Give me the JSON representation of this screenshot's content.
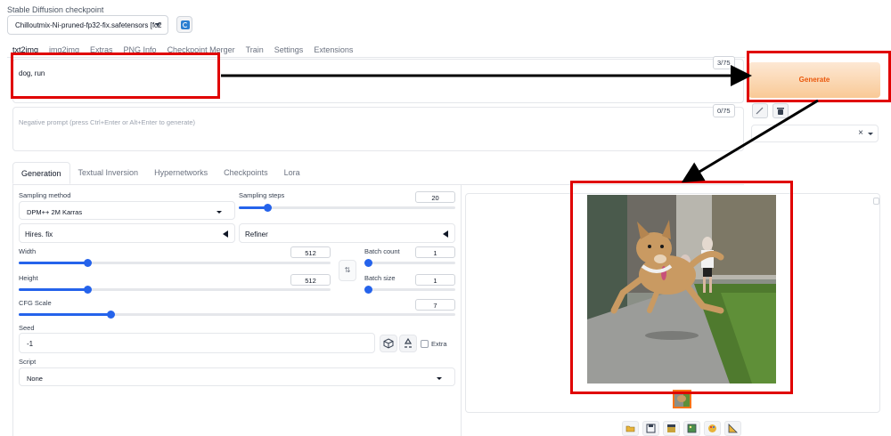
{
  "checkpoint": {
    "label": "Stable Diffusion checkpoint",
    "value": "Chilloutmix-Ni-pruned-fp32-fix.safetensors [fc2"
  },
  "top_tabs": [
    "txt2img",
    "img2img",
    "Extras",
    "PNG Info",
    "Checkpoint Merger",
    "Train",
    "Settings",
    "Extensions"
  ],
  "prompt": {
    "value": "dog, run",
    "counter": "3/75"
  },
  "negative_prompt": {
    "placeholder": "Negative prompt (press Ctrl+Enter or Alt+Enter to generate)",
    "counter": "0/75"
  },
  "generate_label": "Generate",
  "style_clear": "×",
  "sub_tabs": [
    "Generation",
    "Textual Inversion",
    "Hypernetworks",
    "Checkpoints",
    "Lora"
  ],
  "generation": {
    "sampling_method_label": "Sampling method",
    "sampling_method_value": "DPM++ 2M Karras",
    "sampling_steps_label": "Sampling steps",
    "sampling_steps_value": "20",
    "sampling_steps_fraction": 0.13,
    "hires_label": "Hires. fix",
    "refiner_label": "Refiner",
    "width_label": "Width",
    "width_value": "512",
    "width_fraction": 0.22,
    "height_label": "Height",
    "height_value": "512",
    "height_fraction": 0.22,
    "batch_count_label": "Batch count",
    "batch_count_value": "1",
    "batch_size_label": "Batch size",
    "batch_size_value": "1",
    "cfg_label": "CFG Scale",
    "cfg_value": "7",
    "cfg_fraction": 0.21,
    "seed_label": "Seed",
    "seed_value": "-1",
    "extra_label": "Extra",
    "script_label": "Script",
    "script_value": "None"
  },
  "colors": {
    "accent": "#2563eb",
    "generate": "#ea580c",
    "highlight": "#e00000"
  }
}
